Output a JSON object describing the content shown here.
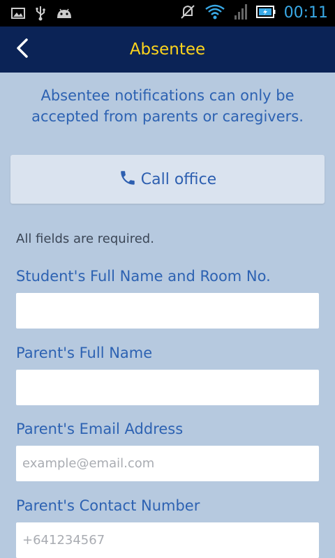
{
  "status_bar": {
    "time": "00:11",
    "icons": [
      "image-icon",
      "usb-icon",
      "android-icon",
      "mute-icon",
      "wifi-icon",
      "signal-icon",
      "battery-icon"
    ]
  },
  "header": {
    "title": "Absentee",
    "back_icon": "chevron-left-icon"
  },
  "notice": "Absentee notifications can only be accepted from parents or caregivers.",
  "call_button": {
    "label": "Call office",
    "icon": "phone-icon"
  },
  "form": {
    "required_note": "All fields are required.",
    "fields": [
      {
        "label": "Student's Full Name and Room No.",
        "value": "",
        "placeholder": ""
      },
      {
        "label": "Parent's Full Name",
        "value": "",
        "placeholder": ""
      },
      {
        "label": "Parent's Email Address",
        "value": "",
        "placeholder": "example@email.com"
      },
      {
        "label": "Parent's Contact Number",
        "value": "",
        "placeholder": "+641234567"
      }
    ]
  },
  "colors": {
    "status_bar": "#000000",
    "app_bar": "#0b2356",
    "title": "#ffd51c",
    "background": "#b6c9df",
    "accent_text": "#2d62b2",
    "call_button_bg": "#dae3ef",
    "time": "#39a9e6"
  }
}
